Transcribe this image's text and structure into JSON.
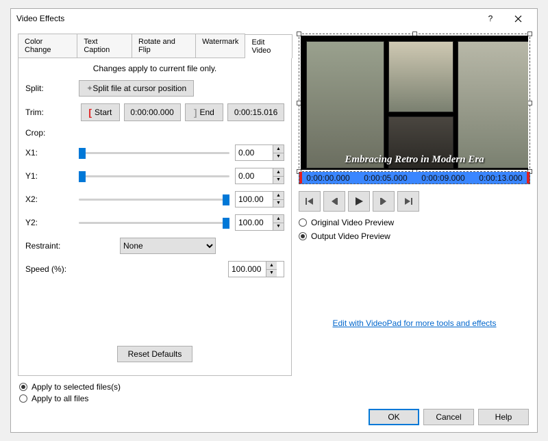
{
  "title": "Video Effects",
  "tabs": [
    "Color Change",
    "Text Caption",
    "Rotate and Flip",
    "Watermark",
    "Edit Video"
  ],
  "active_tab": "Edit Video",
  "panel": {
    "note": "Changes apply to current file only.",
    "split_label": "Split:",
    "split_button": "Split file at cursor position",
    "trim_label": "Trim:",
    "trim_start": "Start",
    "trim_start_time": "0:00:00.000",
    "trim_end": "End",
    "trim_end_time": "0:00:15.016",
    "crop_label": "Crop:",
    "x1_label": "X1:",
    "x1_value": "0.00",
    "y1_label": "Y1:",
    "y1_value": "0.00",
    "x2_label": "X2:",
    "x2_value": "100.00",
    "y2_label": "Y2:",
    "y2_value": "100.00",
    "restraint_label": "Restraint:",
    "restraint_value": "None",
    "speed_label": "Speed (%):",
    "speed_value": "100.000",
    "reset": "Reset Defaults"
  },
  "preview": {
    "caption": "Embracing Retro in Modern Era",
    "timeline": [
      "0:00:00.000",
      "0:00:05.000",
      "0:00:09.000",
      "0:00:13.000"
    ],
    "original_label": "Original Video Preview",
    "output_label": "Output Video Preview",
    "selected": "output",
    "link": "Edit with VideoPad for more tools and effects"
  },
  "apply": {
    "selected_label": "Apply to selected files(s)",
    "all_label": "Apply to all files",
    "choice": "selected"
  },
  "buttons": {
    "ok": "OK",
    "cancel": "Cancel",
    "help": "Help"
  }
}
